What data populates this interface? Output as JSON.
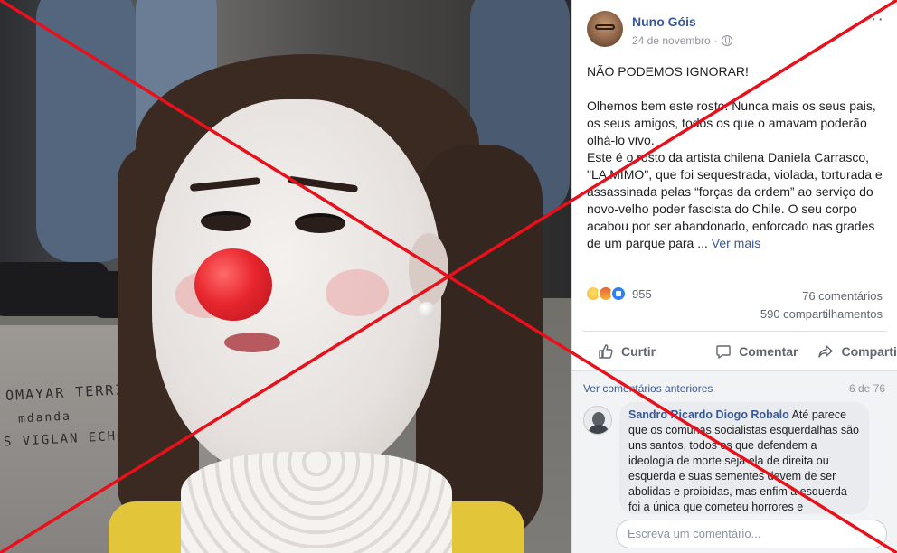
{
  "post": {
    "author": "Nuno Góis",
    "date": "24 de novembro",
    "more_menu": "···",
    "text_headline": "NÃO PODEMOS IGNORAR!",
    "text_body": "Olhemos bem este rosto. Nunca mais os seus pais, os seus amigos, todos os que o amavam poderão olhá-lo vivo.\nEste é o rosto da artista chilena Daniela Carrasco, \"LA MIMO\", que foi sequestrada, violada, torturada e assassinada pelas “forças da ordem” ao serviço do novo-velho poder fascista do Chile. O seu corpo acabou por ser abandonado, enforcado nas grades de um parque para ... ",
    "see_more": "Ver mais"
  },
  "stats": {
    "reactions_count": "955",
    "comments_count": "76 comentários",
    "shares_count": "590 compartilhamentos",
    "reaction_icons": [
      "sad-emoji",
      "angry-emoji",
      "like-thumb"
    ]
  },
  "actions": {
    "like": "Curtir",
    "comment": "Comentar",
    "share": "Compartilhar"
  },
  "comments": {
    "view_previous": "Ver comentários anteriores",
    "pagination": "6 de 76",
    "first": {
      "author": "Sandro Ricardo Diogo Robalo",
      "text": "Até parece que os comunas socialistas esquerdalhas são uns santos, todos os que defendem a ideologia de morte seja ela de direita ou esquerda e suas sementes devem de ser abolidas e proibidas, mas enfim a esquerda foi a única que cometeu horrores e"
    },
    "composer_placeholder": "Escreva um comentário..."
  },
  "photo": {
    "graffiti_1": "OMAYAR  TERRIBE",
    "graffiti_2": "S  VIGLAN  ECHO",
    "graffiti_3": "mdanda"
  },
  "colors": {
    "link_blue": "#385898",
    "overlay_red": "#e8101a",
    "nose_red": "#e8262e"
  }
}
